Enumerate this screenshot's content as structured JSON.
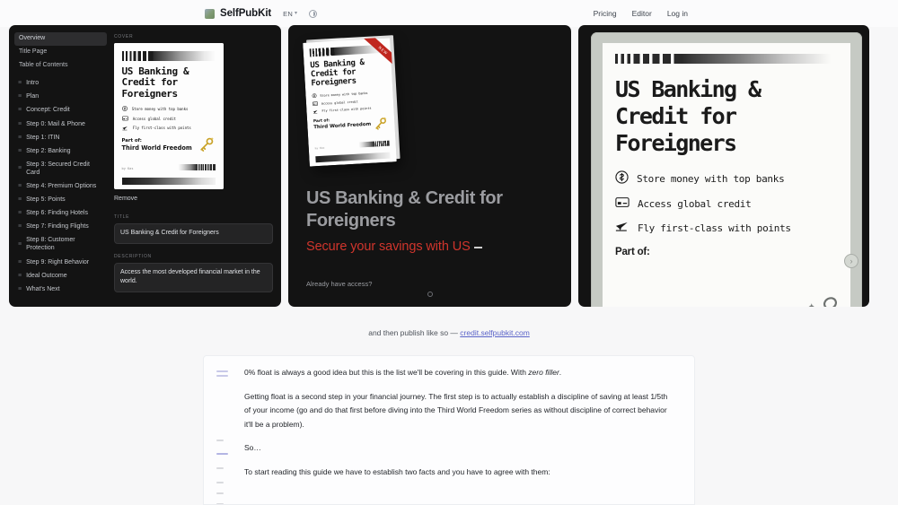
{
  "header": {
    "brand": "SelfPubKit",
    "lang": "EN",
    "lang_caret": "▾",
    "nav": [
      {
        "label": "Pricing"
      },
      {
        "label": "Editor"
      },
      {
        "label": "Log in"
      }
    ]
  },
  "editor_sidebar": {
    "top_items": [
      {
        "label": "Overview",
        "selected": true
      },
      {
        "label": "Title Page",
        "selected": false
      },
      {
        "label": "Table of Contents",
        "selected": false
      }
    ],
    "grip": "≡",
    "chapters": [
      {
        "label": "Intro"
      },
      {
        "label": "Plan"
      },
      {
        "label": "Concept: Credit"
      },
      {
        "label": "Step 0: Mail & Phone"
      },
      {
        "label": "Step 1: ITIN"
      },
      {
        "label": "Step 2: Banking"
      },
      {
        "label": "Step 3: Secured Credit Card"
      },
      {
        "label": "Step 4: Premium Options"
      },
      {
        "label": "Step 5: Points"
      },
      {
        "label": "Step 6: Finding Hotels"
      },
      {
        "label": "Step 7: Finding Flights"
      },
      {
        "label": "Step 8: Customer Protection"
      },
      {
        "label": "Step 9: Right Behavior"
      },
      {
        "label": "Ideal Outcome"
      },
      {
        "label": "What's Next"
      }
    ]
  },
  "cover_form": {
    "cover_label": "COVER",
    "remove_label": "Remove",
    "title_label": "TITLE",
    "title_value": "US Banking & Credit for Foreigners",
    "description_label": "DESCRIPTION",
    "description_value": "Access the most developed financial market in the world."
  },
  "book_cover": {
    "title_line1": "US Banking &",
    "title_line2": "Credit for",
    "title_line3": "Foreigners",
    "bullets": [
      {
        "icon": "dollar-coin-icon",
        "text": "Store money with top banks"
      },
      {
        "icon": "credit-card-icon",
        "text": "Access global credit"
      },
      {
        "icon": "airplane-icon",
        "text": "Fly first-class with points"
      }
    ],
    "part_of_label": "Part of:",
    "series": "Third World Freedom",
    "author": "by Kas",
    "ribbon": "NEW"
  },
  "promo": {
    "headline": "US Banking & Credit for Foreigners",
    "subhead": "Secure your savings with US",
    "footer_link": "Already have access?"
  },
  "caption": {
    "text": "and then publish like so —",
    "link": "credit.selfpubkit.com"
  },
  "document": {
    "paragraphs": [
      {
        "text": "0% float is always a good idea but this is the list we'll be covering in this guide. With ",
        "italic": "zero filler",
        "tail": "."
      },
      {
        "text": "Getting float is a second step in your financial journey. The first step is to actually establish a discipline of saving at least 1/5th of your income (go and do that first before diving into the Third World Freedom series as without discipline of correct behavior it'll be a problem)."
      },
      {
        "text": "So…"
      },
      {
        "text": "To start reading this guide we have to establish two facts and you have to agree with them:"
      }
    ]
  },
  "colors": {
    "accent_red": "#d0352c",
    "link_purple": "#5a63c8",
    "panel_dark": "#131313",
    "device_bezel": "#c6cac4"
  }
}
